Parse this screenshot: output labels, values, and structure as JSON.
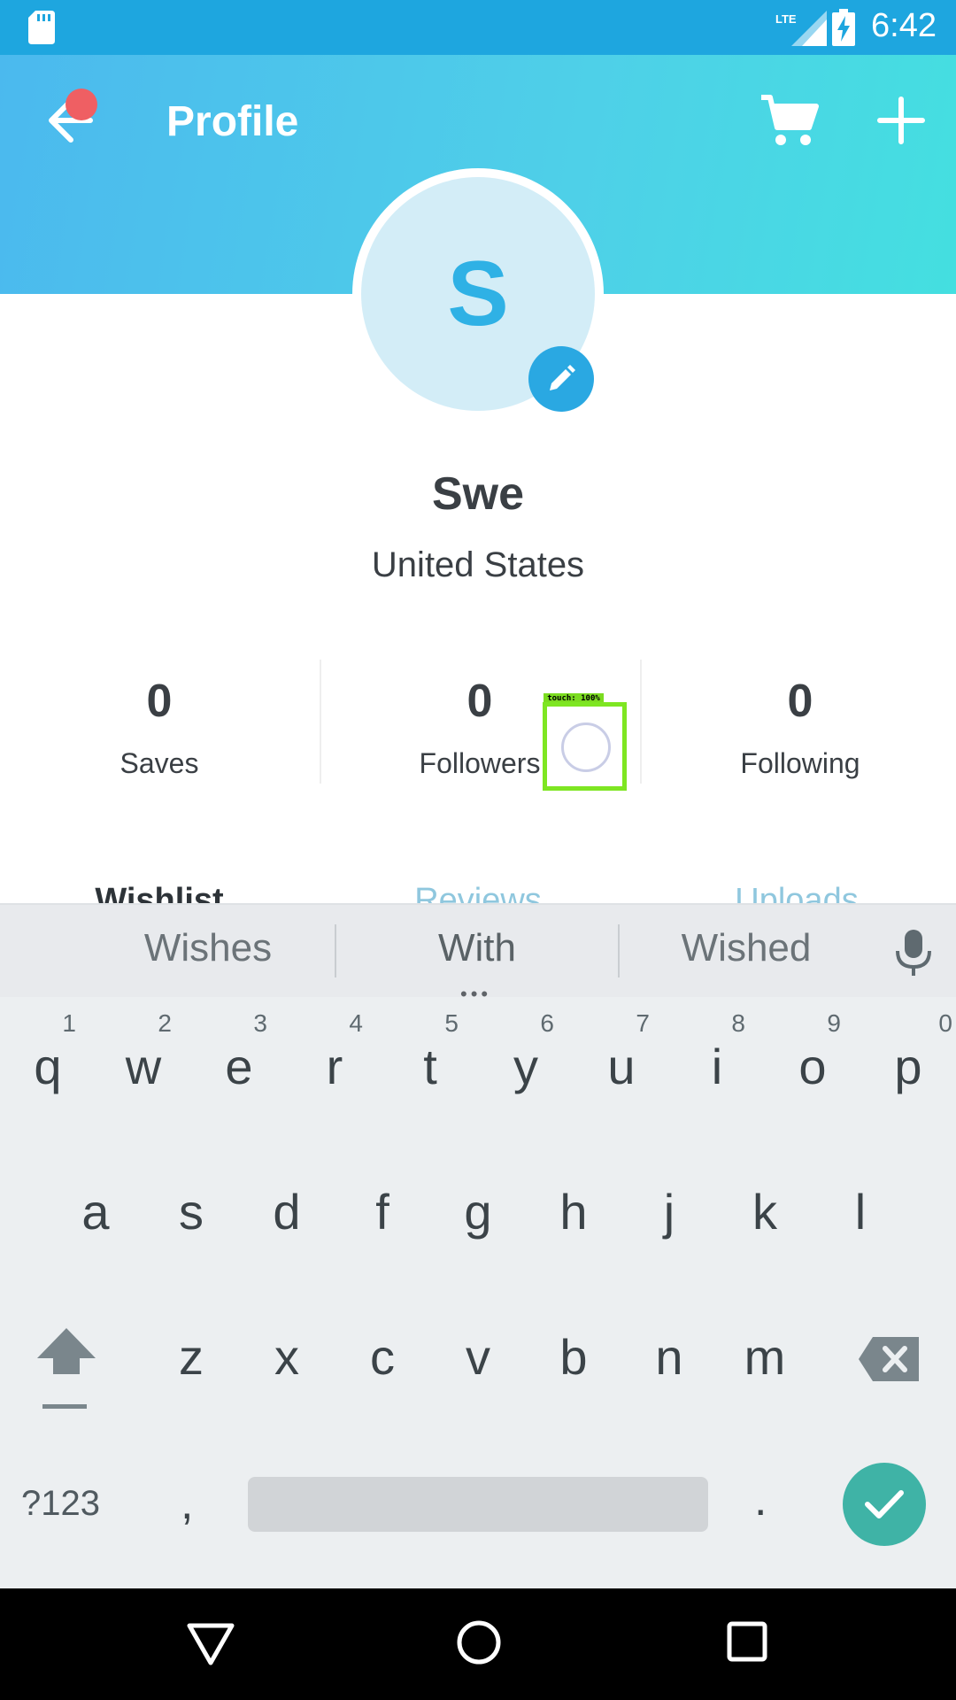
{
  "status_bar": {
    "time": "6:42",
    "network": "LTE"
  },
  "header": {
    "title": "Profile"
  },
  "profile": {
    "avatar_initial": "S",
    "name": "Swe",
    "location": "United States"
  },
  "stats": [
    {
      "value": "0",
      "label": "Saves"
    },
    {
      "value": "0",
      "label": "Followers"
    },
    {
      "value": "0",
      "label": "Following"
    }
  ],
  "tabs": [
    {
      "label": "Wishlist",
      "active": true
    },
    {
      "label": "Reviews",
      "active": false
    },
    {
      "label": "Uploads",
      "active": false
    }
  ],
  "touch_overlay": {
    "label": "touch: 100%"
  },
  "keyboard": {
    "suggestions": [
      "Wishes",
      "With",
      "Wished"
    ],
    "row1": [
      {
        "char": "q",
        "hint": "1"
      },
      {
        "char": "w",
        "hint": "2"
      },
      {
        "char": "e",
        "hint": "3"
      },
      {
        "char": "r",
        "hint": "4"
      },
      {
        "char": "t",
        "hint": "5"
      },
      {
        "char": "y",
        "hint": "6"
      },
      {
        "char": "u",
        "hint": "7"
      },
      {
        "char": "i",
        "hint": "8"
      },
      {
        "char": "o",
        "hint": "9"
      },
      {
        "char": "p",
        "hint": "0"
      }
    ],
    "row2": [
      "a",
      "s",
      "d",
      "f",
      "g",
      "h",
      "j",
      "k",
      "l"
    ],
    "row3": [
      "z",
      "x",
      "c",
      "v",
      "b",
      "n",
      "m"
    ],
    "symbols_label": "?123",
    "comma": ",",
    "period": "."
  },
  "colors": {
    "accent": "#2aa8e2",
    "status_bar": "#1ea6df",
    "notification_dot": "#ef5f63",
    "enter_key": "#3fb3a6"
  }
}
